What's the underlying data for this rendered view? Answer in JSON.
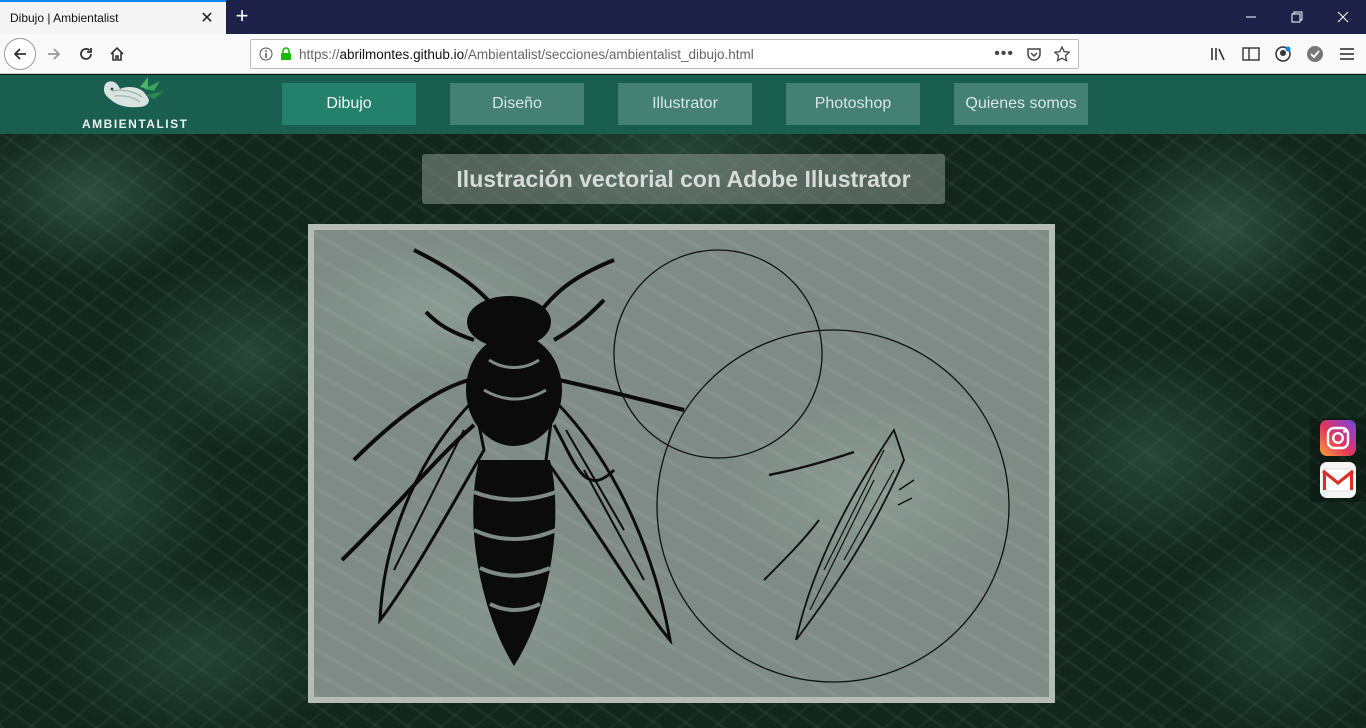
{
  "browser": {
    "tab_title": "Dibujo | Ambientalist",
    "url_prefix": "https://",
    "url_host": "abrilmontes.github.io",
    "url_path": "/Ambientalist/secciones/ambientalist_dibujo.html"
  },
  "site": {
    "logo_text": "AMBIENTALIST",
    "menu": [
      {
        "label": "Dibujo",
        "active": true
      },
      {
        "label": "Diseño",
        "active": false
      },
      {
        "label": "Illustrator",
        "active": false
      },
      {
        "label": "Photoshop",
        "active": false
      },
      {
        "label": "Quienes somos",
        "active": false
      }
    ],
    "title": "Ilustración vectorial con Adobe Illustrator"
  },
  "social": [
    "instagram-icon",
    "gmail-icon"
  ],
  "colors": {
    "header": "#1a5e50",
    "menu_active": "#22806b",
    "tab_accent": "#0a84ff"
  }
}
